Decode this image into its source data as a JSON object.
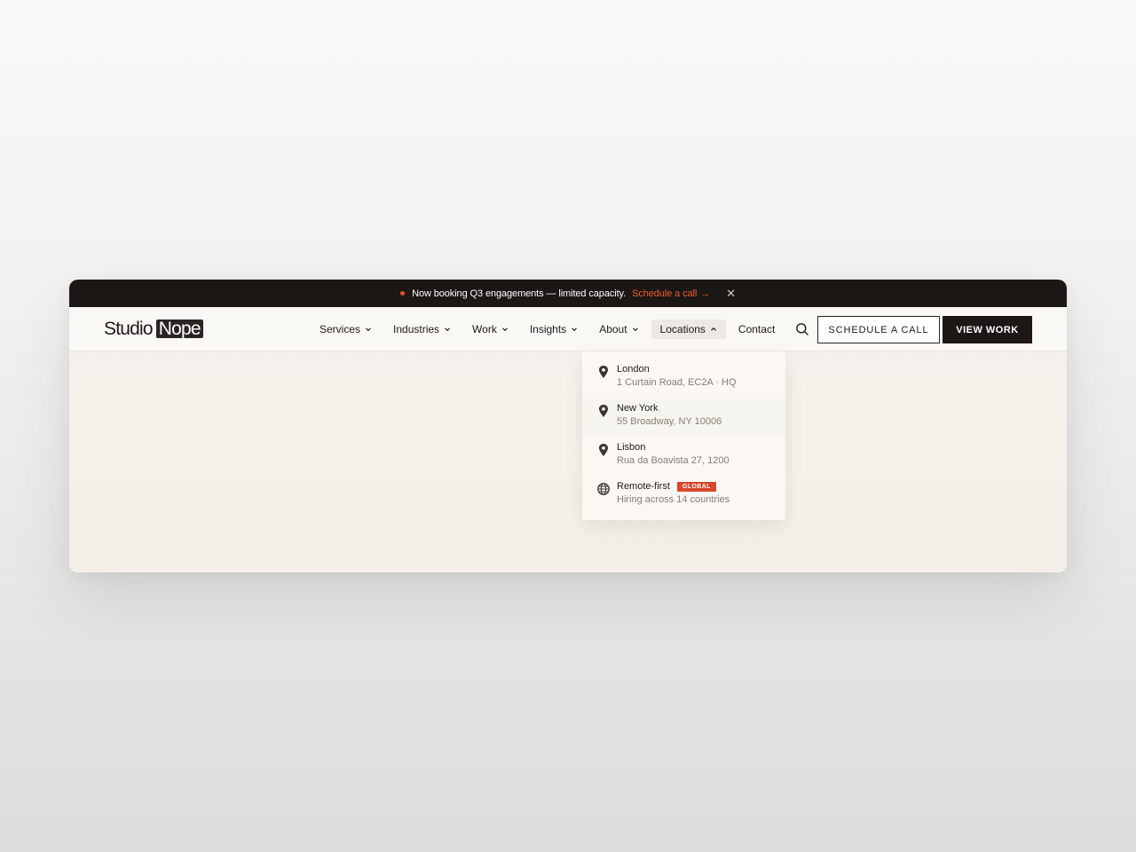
{
  "announcement": {
    "text": "Now booking Q3 engagements — limited capacity.",
    "cta_label": "Schedule a call",
    "cta_arrow": "→",
    "close_label": "✕"
  },
  "logo": {
    "first": "Studio",
    "second": "Nope"
  },
  "nav": {
    "items": [
      {
        "label": "Services",
        "has_chevron": true,
        "active": false
      },
      {
        "label": "Industries",
        "has_chevron": true,
        "active": false
      },
      {
        "label": "Work",
        "has_chevron": true,
        "active": false
      },
      {
        "label": "Insights",
        "has_chevron": true,
        "active": false
      },
      {
        "label": "About",
        "has_chevron": true,
        "active": false
      },
      {
        "label": "Locations",
        "has_chevron": true,
        "active": true
      },
      {
        "label": "Contact",
        "has_chevron": false,
        "active": false
      }
    ],
    "search_icon": "search-icon"
  },
  "buttons": {
    "schedule": "SCHEDULE A CALL",
    "view_work": "VIEW WORK"
  },
  "locations": [
    {
      "name": "London",
      "address": "1 Curtain Road, EC2A · HQ",
      "icon": "map-pin-icon"
    },
    {
      "name": "New York",
      "address": "55 Broadway, NY 10006",
      "icon": "map-pin-icon"
    },
    {
      "name": "Lisbon",
      "address": "Rua da Boavista 27, 1200",
      "icon": "map-pin-icon"
    },
    {
      "name": "Remote-first",
      "address": "Hiring across 14 countries",
      "icon": "globe-icon",
      "badge": "GLOBAL"
    }
  ],
  "colors": {
    "accent": "#e4522c",
    "dark": "#1b1714",
    "badge": "#d9472b"
  }
}
